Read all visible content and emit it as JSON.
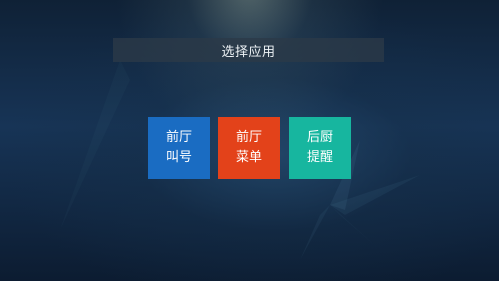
{
  "header": {
    "title": "选择应用"
  },
  "apps": [
    {
      "line1": "前厅",
      "line2": "叫号",
      "color": "#1a6cc2"
    },
    {
      "line1": "前厅",
      "line2": "菜单",
      "color": "#e3421a"
    },
    {
      "line1": "后厨",
      "line2": "提醒",
      "color": "#17b69f"
    }
  ]
}
